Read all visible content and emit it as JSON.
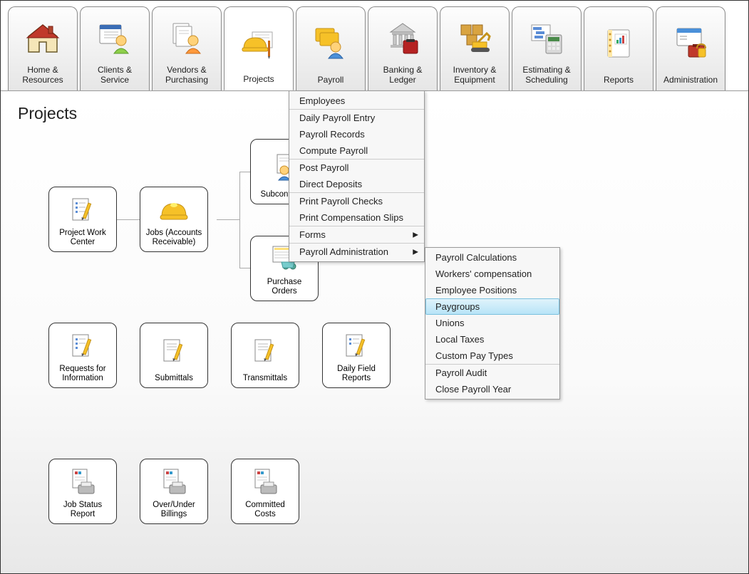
{
  "tabs": [
    {
      "label": "Home &\nResources"
    },
    {
      "label": "Clients &\nService"
    },
    {
      "label": "Vendors &\nPurchasing"
    },
    {
      "label": "Projects"
    },
    {
      "label": "Payroll"
    },
    {
      "label": "Banking &\nLedger"
    },
    {
      "label": "Inventory &\nEquipment"
    },
    {
      "label": "Estimating &\nScheduling"
    },
    {
      "label": "Reports"
    },
    {
      "label": "Administration"
    }
  ],
  "page_title": "Projects",
  "nodes": {
    "pwc": "Project Work Center",
    "jobs": "Jobs (Accounts Receivable)",
    "sub": "Subcontracts",
    "po": "Purchase Orders",
    "rfi": "Requests for Information",
    "subm": "Submittals",
    "trans": "Transmittals",
    "dfr": "Daily Field Reports",
    "jsr": "Job Status Report",
    "oub": "Over/Under Billings",
    "cc": "Committed Costs"
  },
  "menu1": {
    "employees": "Employees",
    "dpe": "Daily Payroll Entry",
    "records": "Payroll Records",
    "compute": "Compute Payroll",
    "post": "Post Payroll",
    "dd": "Direct Deposits",
    "checks": "Print Payroll Checks",
    "slips": "Print Compensation Slips",
    "forms": "Forms",
    "admin": "Payroll Administration"
  },
  "menu2": {
    "calc": "Payroll Calculations",
    "wc": "Workers' compensation",
    "ep": "Employee Positions",
    "pg": "Paygroups",
    "unions": "Unions",
    "lt": "Local Taxes",
    "cpt": "Custom Pay Types",
    "audit": "Payroll Audit",
    "close": "Close Payroll Year"
  }
}
